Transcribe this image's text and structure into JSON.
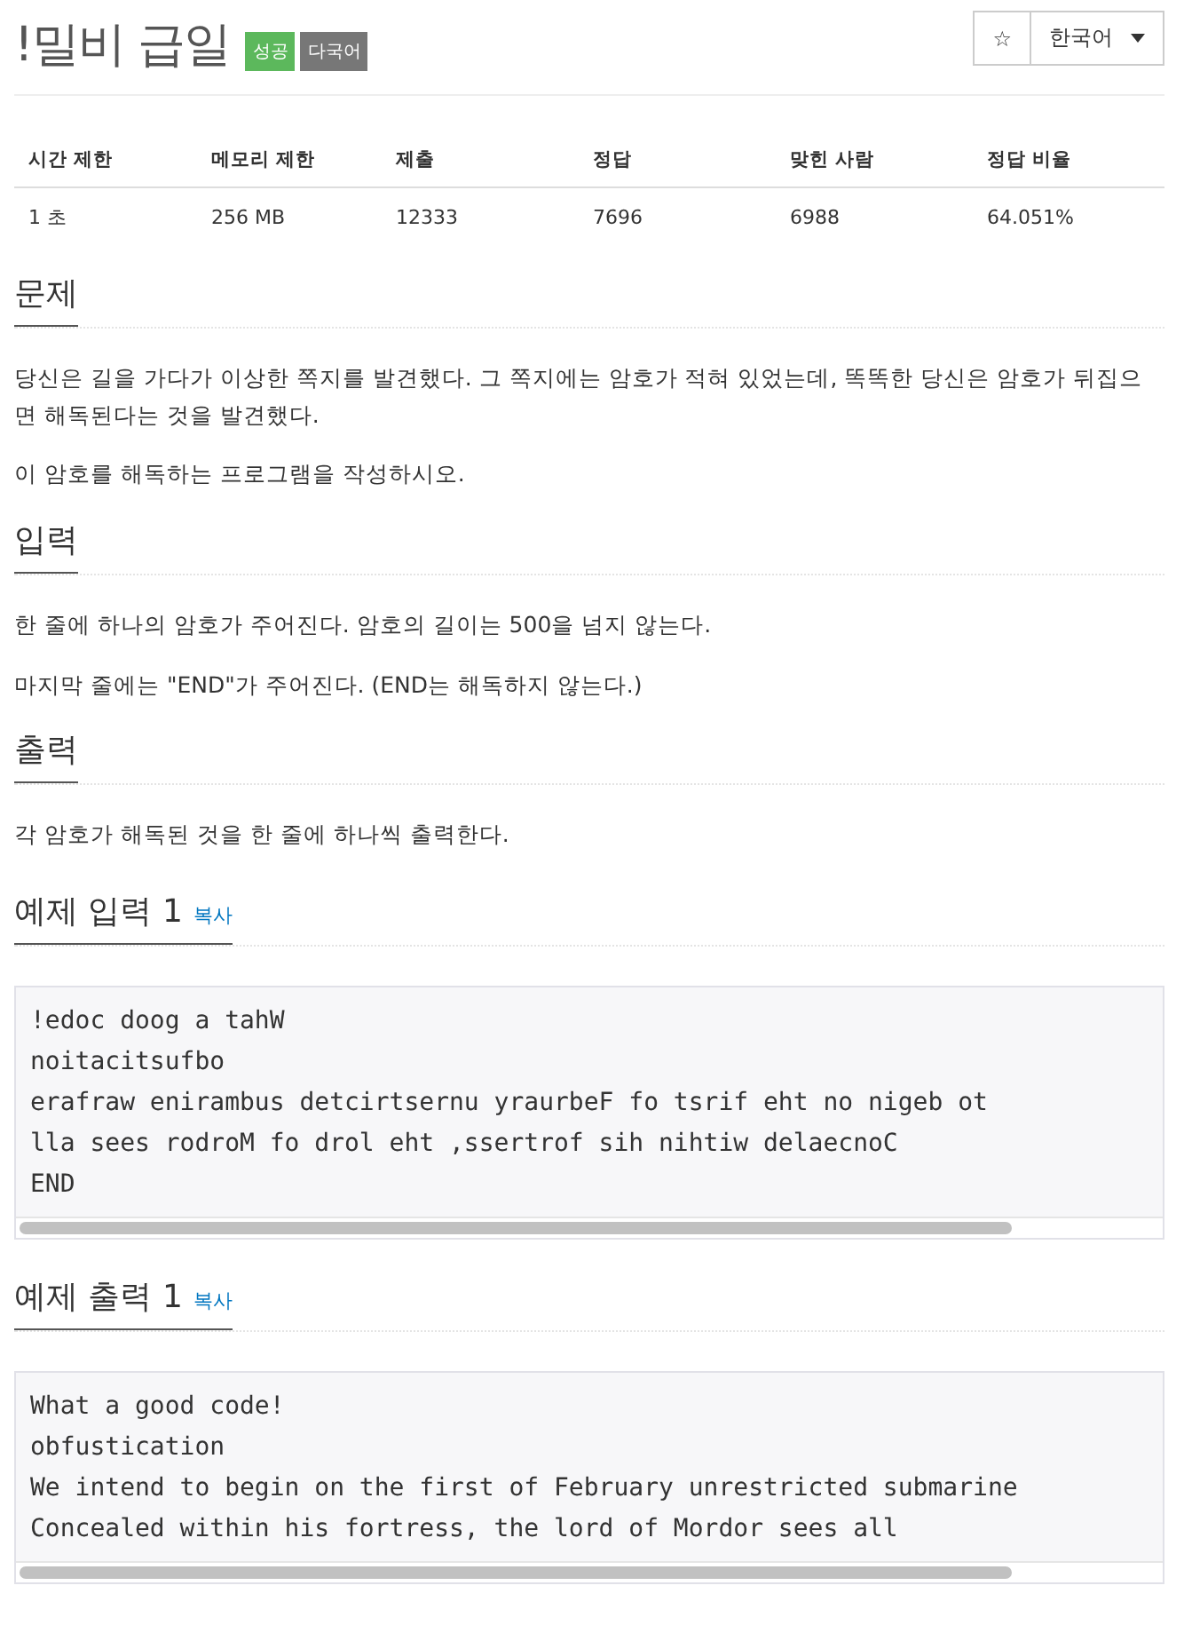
{
  "title": "!밀비 급일",
  "badges": [
    {
      "label": "성공",
      "color": "#5cb85c"
    },
    {
      "label": "다국어",
      "color": "#777777"
    }
  ],
  "star_button": "☆",
  "language": {
    "value": "한국어"
  },
  "stats": {
    "columns": [
      "시간 제한",
      "메모리 제한",
      "제출",
      "정답",
      "맞힌 사람",
      "정답 비율"
    ],
    "rows": [
      [
        "1 초",
        "256 MB",
        "12333",
        "7696",
        "6988",
        "64.051%"
      ]
    ]
  },
  "sections": [
    {
      "heading": "문제",
      "paragraphs": [
        "당신은 길을 가다가 이상한 쪽지를 발견했다. 그 쪽지에는 암호가 적혀 있었는데, 똑똑한 당신은 암호가 뒤집으면 해독된다는 것을 발견했다.",
        "이 암호를 해독하는 프로그램을 작성하시오."
      ]
    },
    {
      "heading": "입력",
      "paragraphs": [
        "한 줄에 하나의 암호가 주어진다. 암호의 길이는 500을 넘지 않는다.",
        "마지막 줄에는 \"END\"가 주어진다. (END는 해독하지 않는다.)"
      ]
    },
    {
      "heading": "출력",
      "paragraphs": [
        "각 암호가 해독된 것을 한 줄에 하나씩 출력한다."
      ]
    }
  ],
  "examples": [
    {
      "heading": "예제 입력 1",
      "copy": "복사",
      "lines": [
        "!edoc doog a tahW",
        "noitacitsufbo",
        "erafraw enirambus detcirtsernu yraurbeF fo tsrif eht no nigeb ot",
        "lla sees rodroM fo drol eht ,ssertrof sih nihtiw delaecnoC",
        "END"
      ]
    },
    {
      "heading": "예제 출력 1",
      "copy": "복사",
      "lines": [
        "What a good code!",
        "obfustication",
        "We intend to begin on the first of February unrestricted submarine",
        "Concealed within his fortress, the lord of Mordor sees all"
      ]
    }
  ]
}
